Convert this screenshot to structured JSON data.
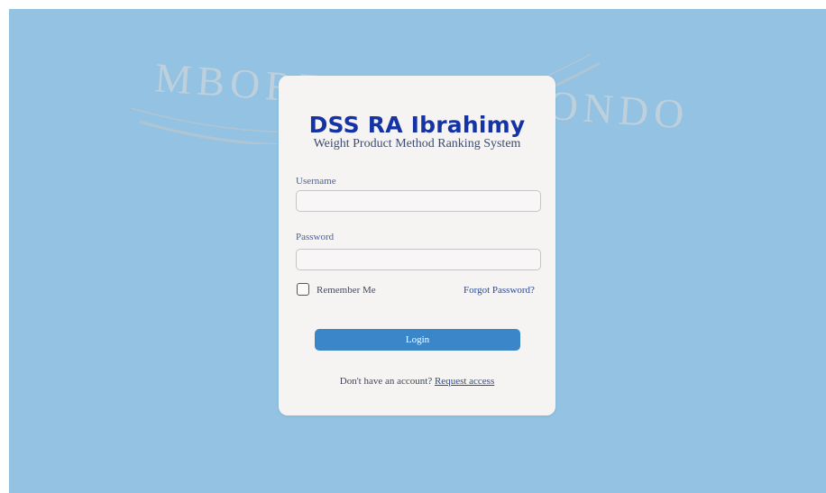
{
  "watermark": {
    "text": "MBOREJO SITUBONDO"
  },
  "login": {
    "app_title": "DSS RA Ibrahimy",
    "app_subtitle": "Weight Product Method Ranking System",
    "username_label": "Username",
    "username_value": "",
    "password_label": "Password",
    "password_value": "",
    "remember_label": "Remember Me",
    "remember_checked": false,
    "forgot_label": "Forgot Password?",
    "login_label": "Login",
    "footer_text": "Don't have an account?",
    "request_access_label": "Request access"
  },
  "colors": {
    "backdrop": "#93c2e2",
    "card": "#f6f3f3",
    "title": "#1433a5",
    "button": "#3b86c9"
  }
}
